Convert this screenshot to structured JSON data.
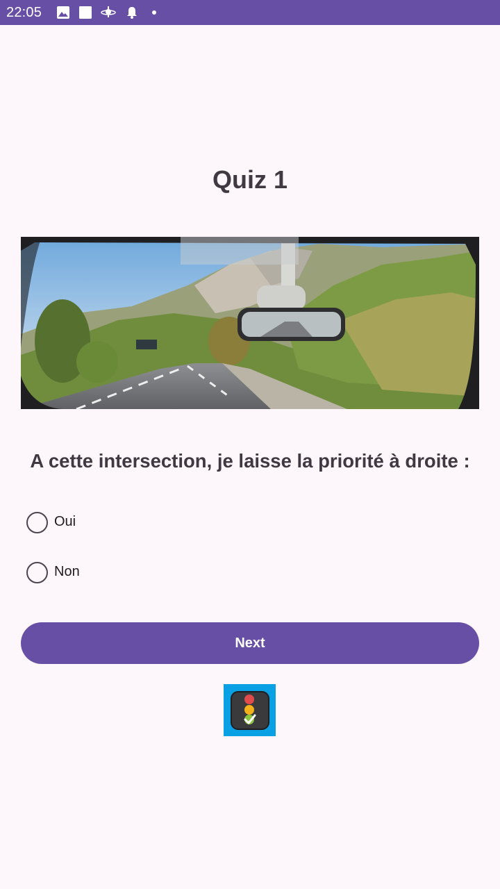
{
  "status_bar": {
    "time": "22:05",
    "icons": [
      "image-icon",
      "square-icon",
      "satellite-icon",
      "bell-icon",
      "dot-icon"
    ],
    "background": "#674fa5"
  },
  "quiz": {
    "title": "Quiz 1",
    "image_icon": "road-windshield-photo",
    "question": "A cette intersection, je laisse la priorité à droite :",
    "options": [
      {
        "label": "Oui",
        "selected": false
      },
      {
        "label": "Non",
        "selected": false
      }
    ],
    "next_label": "Next",
    "logo_icon": "traffic-light-check-icon"
  },
  "colors": {
    "accent": "#674fa5",
    "background": "#fdf7fc",
    "text": "#3f3a42",
    "logo_bg": "#0aa0e4"
  }
}
